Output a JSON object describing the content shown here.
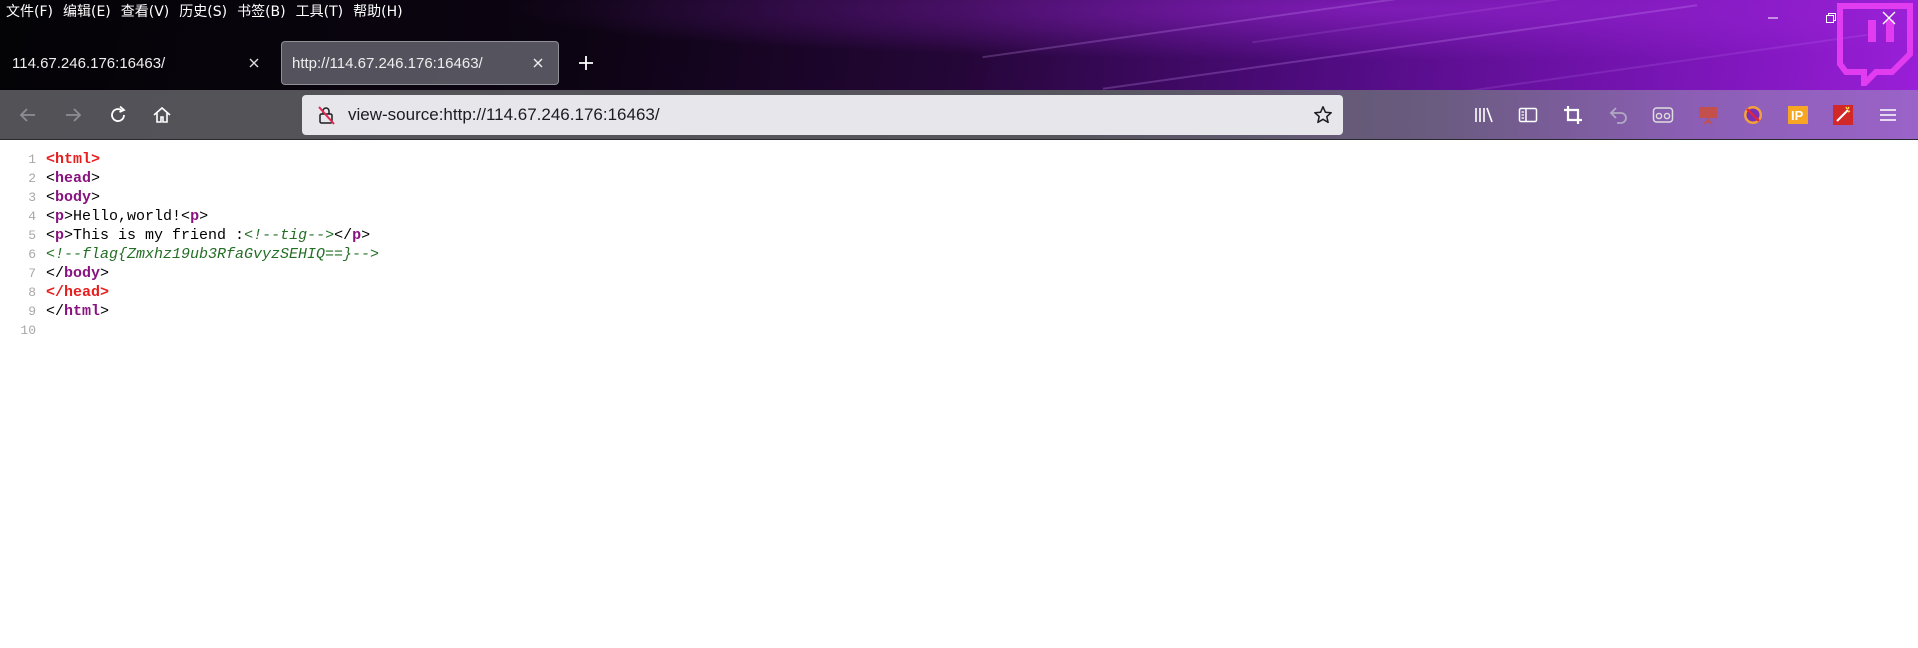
{
  "menu": {
    "items": [
      "文件(F)",
      "编辑(E)",
      "查看(V)",
      "历史(S)",
      "书签(B)",
      "工具(T)",
      "帮助(H)"
    ]
  },
  "tabs": [
    {
      "label": "114.67.246.176:16463/",
      "active": false
    },
    {
      "label": "http://114.67.246.176:16463/",
      "active": true
    }
  ],
  "urlbar": {
    "value": "view-source:http://114.67.246.176:16463/"
  },
  "toolbar_icons": [
    "library-icon",
    "sidebar-icon",
    "crop-icon",
    "undo-icon",
    "glasses-icon",
    "presentation-icon",
    "block-icon",
    "ip-icon",
    "wand-icon",
    "menu-icon"
  ],
  "source": {
    "lines": [
      {
        "n": "1",
        "parts": [
          [
            "red",
            "<html>"
          ]
        ]
      },
      {
        "n": "2",
        "parts": [
          [
            "plain",
            "<"
          ],
          [
            "purple",
            "head"
          ],
          [
            "plain",
            ">"
          ]
        ]
      },
      {
        "n": "3",
        "parts": [
          [
            "plain",
            "<"
          ],
          [
            "purple",
            "body"
          ],
          [
            "plain",
            ">"
          ]
        ]
      },
      {
        "n": "4",
        "parts": [
          [
            "plain",
            "<"
          ],
          [
            "purple",
            "p"
          ],
          [
            "plain",
            ">Hello,world!<"
          ],
          [
            "purple",
            "p"
          ],
          [
            "plain",
            ">"
          ]
        ]
      },
      {
        "n": "5",
        "parts": [
          [
            "plain",
            "<"
          ],
          [
            "purple",
            "p"
          ],
          [
            "plain",
            ">This is my friend :"
          ],
          [
            "comment",
            "<!--tig-->"
          ],
          [
            "plain",
            "</"
          ],
          [
            "purple",
            "p"
          ],
          [
            "plain",
            ">"
          ]
        ]
      },
      {
        "n": "6",
        "parts": [
          [
            "comment",
            "<!--flag{Zmxhz19ub3RfaGvyzSEHIQ==}-->"
          ]
        ]
      },
      {
        "n": "7",
        "parts": [
          [
            "plain",
            "</"
          ],
          [
            "purple",
            "body"
          ],
          [
            "plain",
            ">"
          ]
        ]
      },
      {
        "n": "8",
        "parts": [
          [
            "red",
            "</head>"
          ]
        ]
      },
      {
        "n": "9",
        "parts": [
          [
            "plain",
            "</"
          ],
          [
            "purple",
            "html"
          ],
          [
            "plain",
            ">"
          ]
        ]
      },
      {
        "n": "10",
        "parts": []
      }
    ]
  },
  "colors": {
    "tag_red": "#e61e1e",
    "tag_purple": "#881280",
    "comment_green": "#236e25",
    "theme_purple": "#9a1fd8",
    "twitch_magenta": "#e23cf0"
  }
}
